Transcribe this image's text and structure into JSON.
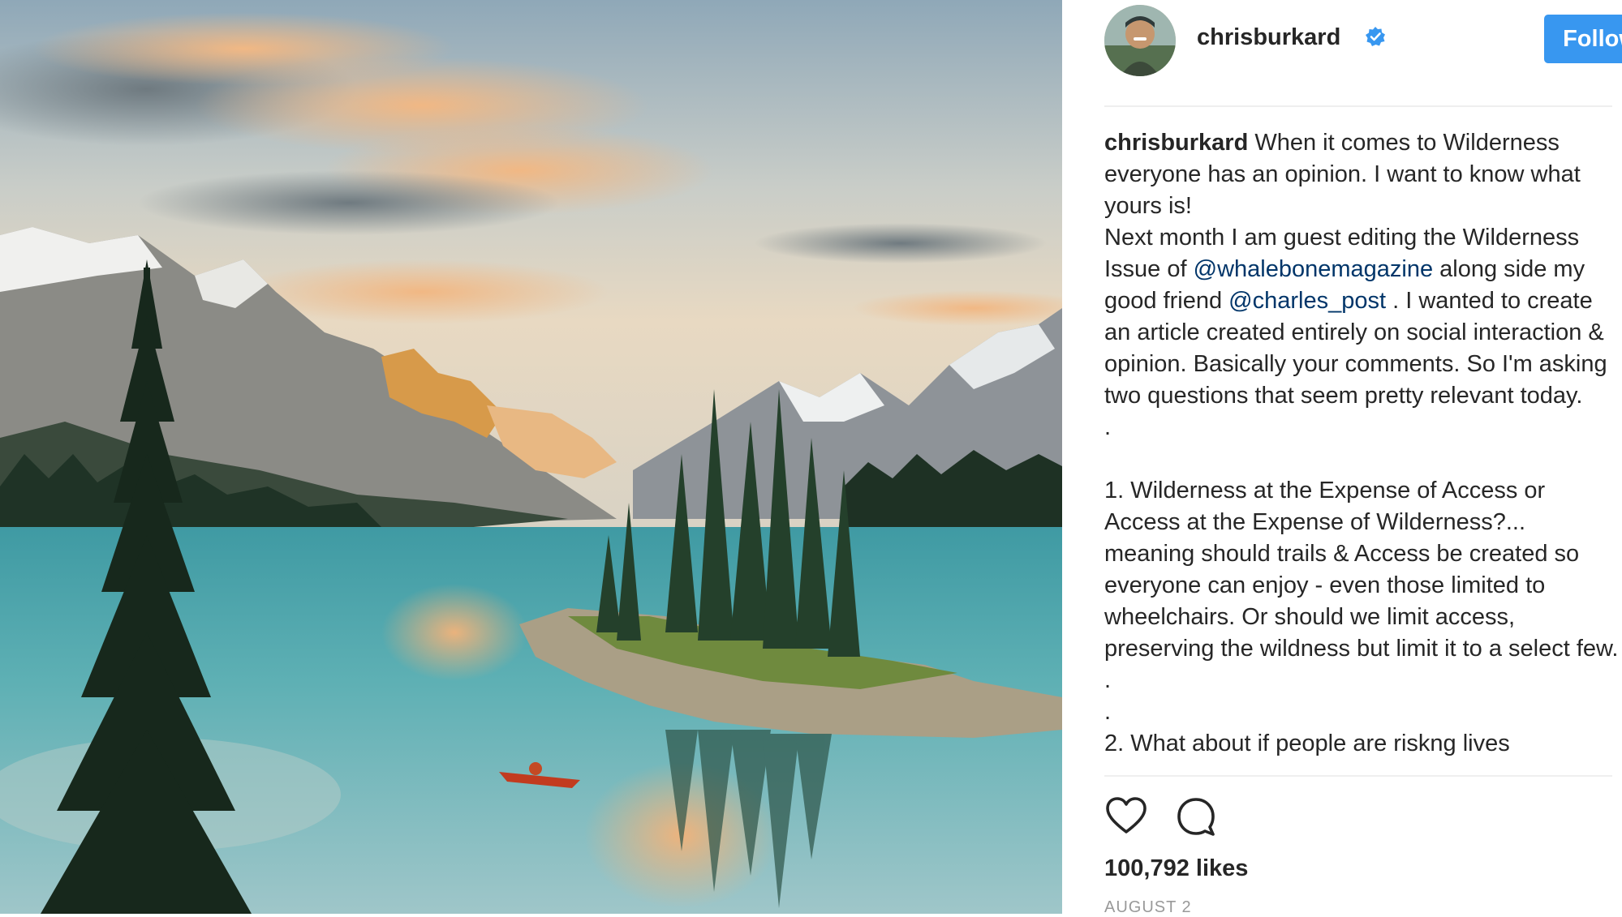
{
  "post": {
    "author": {
      "username": "chrisburkard",
      "verified": true,
      "avatar_icon": "profile-photo"
    },
    "follow_label": "Follow",
    "caption": {
      "author": "chrisburkard",
      "lines": [
        {
          "text": " When it comes to Wilderness everyone has an opinion. I want to know what yours is!"
        },
        {
          "text": "Next month I am guest editing the Wilderness Issue of "
        }
      ],
      "mention_1": "@whalebonemagazine",
      "between_mentions": " along side my good friend ",
      "mention_2": "@charles_post",
      "after_mentions": " . I wanted to create an article created entirely on social interaction & opinion. Basically your comments. So I'm asking two questions that seem pretty relevant today.",
      "dot_1": ".",
      "question_1": "1. Wilderness at the Expense of Access or Access at the Expense of Wilderness?... meaning should trails & Access be created so everyone can enjoy - even those limited to wheelchairs. Or should we limit access, preserving the wildness but limit it to a select few. .",
      "dot_2": ".",
      "question_2_partial": "2. What about if people are riskng lives"
    },
    "icons": {
      "like": "heart-icon",
      "comment": "comment-icon"
    },
    "likes": "100,792 likes",
    "date": "AUGUST 2"
  },
  "colors": {
    "follow_button": "#3897f0",
    "mention": "#003569",
    "verified_badge": "#3897f0"
  }
}
